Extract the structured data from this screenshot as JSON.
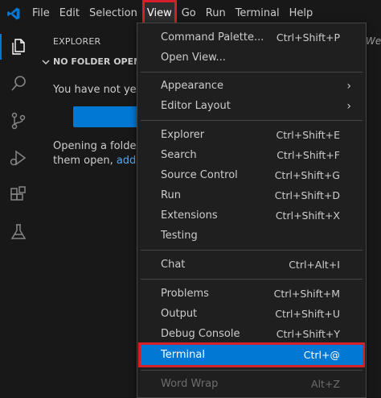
{
  "colors": {
    "accent": "#0078d4",
    "highlight_border": "#d4202b",
    "link": "#4daafc"
  },
  "menubar": {
    "items": [
      {
        "label": "File"
      },
      {
        "label": "Edit"
      },
      {
        "label": "Selection"
      },
      {
        "label": "View",
        "active": true
      },
      {
        "label": "Go"
      },
      {
        "label": "Run"
      },
      {
        "label": "Terminal"
      },
      {
        "label": "Help"
      }
    ]
  },
  "search_peek": "We",
  "activitybar": {
    "icons": [
      "explorer-icon",
      "search-icon",
      "source-control-icon",
      "run-debug-icon",
      "extensions-icon",
      "testing-icon"
    ]
  },
  "sidebar": {
    "title": "EXPLORER",
    "section": "NO FOLDER OPENED",
    "message_1": "You have not yet o",
    "message_2_line1": "Opening a folder w",
    "message_2_line2_prefix": "them open, ",
    "message_2_link": "add a f"
  },
  "view_menu": {
    "command_palette": {
      "label": "Command Palette...",
      "shortcut": "Ctrl+Shift+P"
    },
    "open_view": {
      "label": "Open View..."
    },
    "appearance": {
      "label": "Appearance",
      "arrow": "›"
    },
    "editor_layout": {
      "label": "Editor Layout",
      "arrow": "›"
    },
    "explorer": {
      "label": "Explorer",
      "shortcut": "Ctrl+Shift+E"
    },
    "search": {
      "label": "Search",
      "shortcut": "Ctrl+Shift+F"
    },
    "source_control": {
      "label": "Source Control",
      "shortcut": "Ctrl+Shift+G"
    },
    "run": {
      "label": "Run",
      "shortcut": "Ctrl+Shift+D"
    },
    "extensions": {
      "label": "Extensions",
      "shortcut": "Ctrl+Shift+X"
    },
    "testing": {
      "label": "Testing"
    },
    "chat": {
      "label": "Chat",
      "shortcut": "Ctrl+Alt+I"
    },
    "problems": {
      "label": "Problems",
      "shortcut": "Ctrl+Shift+M"
    },
    "output": {
      "label": "Output",
      "shortcut": "Ctrl+Shift+U"
    },
    "debug_console": {
      "label": "Debug Console",
      "shortcut": "Ctrl+Shift+Y"
    },
    "terminal": {
      "label": "Terminal",
      "shortcut": "Ctrl+@"
    },
    "word_wrap": {
      "label": "Word Wrap",
      "shortcut": "Alt+Z"
    }
  }
}
